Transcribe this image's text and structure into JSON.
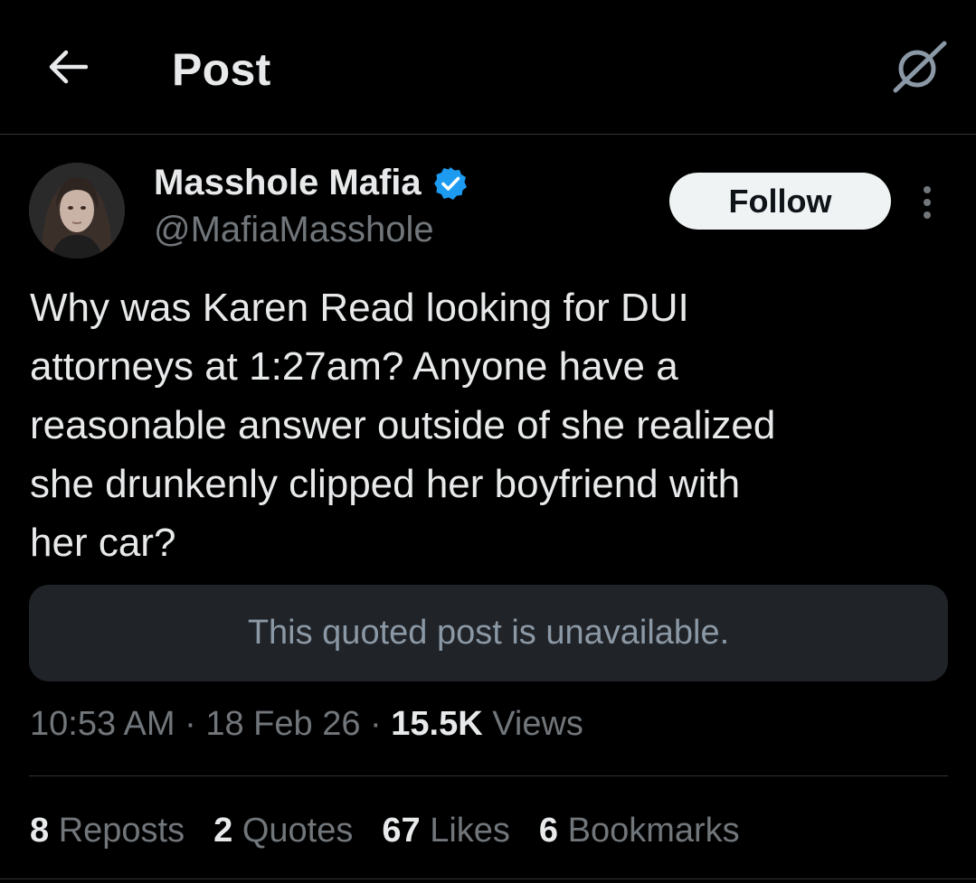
{
  "header": {
    "title": "Post",
    "back_icon": "arrow-left-icon",
    "grok_icon": "grok-icon"
  },
  "author": {
    "name": "Masshole Mafia",
    "handle": "@MafiaMasshole",
    "verified": true,
    "verified_color": "#1d9bf0"
  },
  "follow_label": "Follow",
  "post": {
    "text": "Why was Karen Read looking for DUI\nattorneys at 1:27am? Anyone have a\nreasonable answer outside of she realized\nshe drunkenly clipped her boyfriend with\nher car?"
  },
  "quote": {
    "text": "This quoted post is unavailable."
  },
  "meta": {
    "time": "10:53 AM",
    "date": "18 Feb 26",
    "views_count": "15.5K",
    "views_label": "Views"
  },
  "stats": {
    "reposts": {
      "count": "8",
      "label": "Reposts"
    },
    "quotes": {
      "count": "2",
      "label": "Quotes"
    },
    "likes": {
      "count": "67",
      "label": "Likes"
    },
    "bookmarks": {
      "count": "6",
      "label": "Bookmarks"
    }
  },
  "colors": {
    "background": "#000000",
    "text": "#e7e9ea",
    "muted": "#71767b",
    "accent": "#1d9bf0"
  }
}
